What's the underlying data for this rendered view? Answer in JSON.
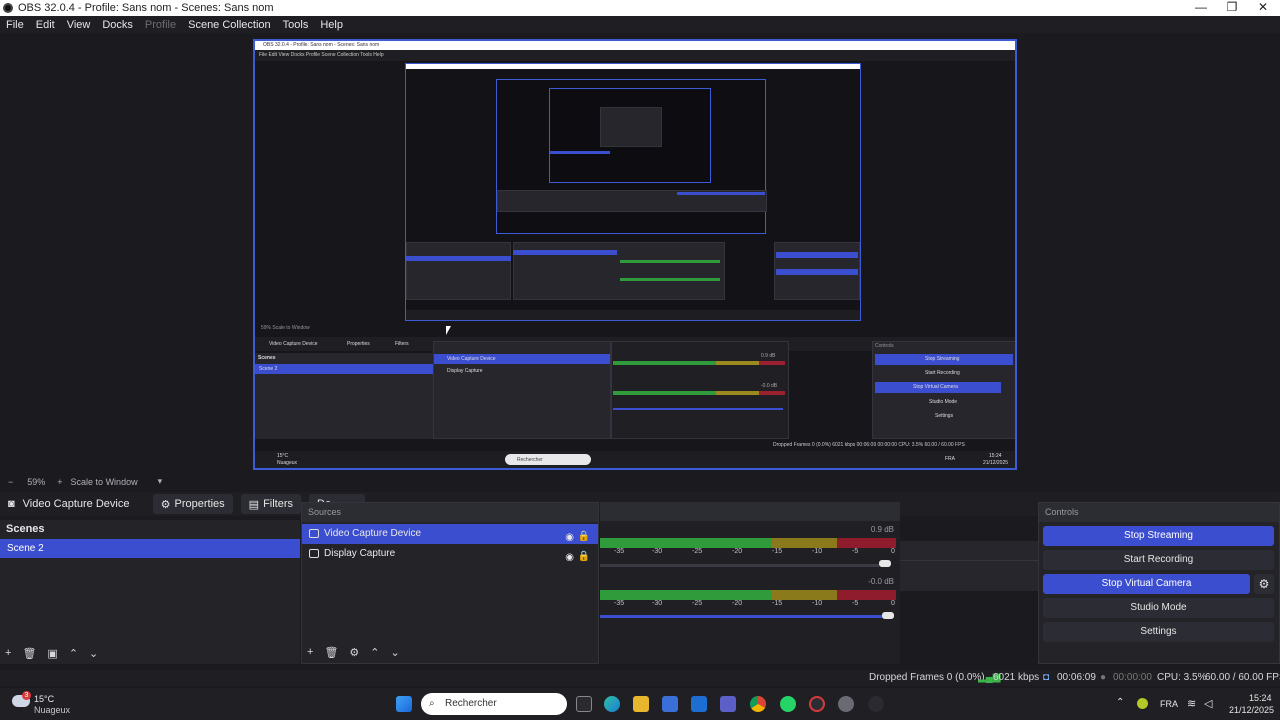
{
  "window": {
    "title": "OBS 32.0.4 - Profile: Sans nom - Scenes: Sans nom",
    "minimize": "—",
    "maximize": "❐",
    "close": "✕"
  },
  "menu": {
    "items": [
      "File",
      "Edit",
      "View",
      "Docks",
      "Profile",
      "Scene Collection",
      "Tools",
      "Help"
    ],
    "disabled": [
      "Profile"
    ]
  },
  "preview_nested": {
    "title": "OBS 32.0.4 - Profile: Sans nom - Scenes: Sans nom",
    "menu": "File  Edit  View  Docks  Profile  Scene Collection  Tools  Help",
    "zoom": "59%   Scale to Window",
    "context_source": "Video Capture Device",
    "context_props": "Properties",
    "context_filters": "Filters",
    "scenes_title": "Scenes",
    "scene": "Scene 2",
    "sources_title": "Sources",
    "src1": "Video Capture Device",
    "src2": "Display Capture",
    "controls_title": "Controls",
    "c1": "Stop Streaming",
    "c2": "Start Recording",
    "c3": "Stop Virtual Camera",
    "c4": "Studio Mode",
    "c5": "Settings",
    "status": "Dropped Frames 0 (0.0%)   6021 kbps   00:06:09   00:00:00   CPU: 3.5%   60.00 / 60.00 FPS",
    "weather": "15°C",
    "weather_desc": "Nuageux",
    "search": "Rechercher",
    "lang": "FRA",
    "time": "15:24",
    "date": "21/12/2025",
    "db1": "0.9 dB",
    "db2": "-0.0 dB"
  },
  "zoom": {
    "minus": "−",
    "level": "59%",
    "plus": "+",
    "mode": "Scale to Window"
  },
  "context": {
    "source_name": "Video Capture Device",
    "properties": "Properties",
    "filters": "Filters",
    "partial": "De"
  },
  "scenes": {
    "title": "Scenes",
    "items": [
      "Scene 2"
    ]
  },
  "sources": {
    "title": "Sources",
    "items": [
      "Video Capture Device",
      "Display Capture"
    ]
  },
  "mixer": {
    "track1_db": "0.9 dB",
    "track2_db": "-0.0 dB",
    "scale": [
      "-45",
      "-40",
      "-35",
      "-30",
      "-25",
      "-20",
      "-15",
      "-10",
      "-5",
      "0"
    ],
    "track1_volume": 0.95,
    "track2_volume": 1.0
  },
  "controls": {
    "title": "Controls",
    "stop_streaming": "Stop Streaming",
    "start_recording": "Start Recording",
    "stop_virtual_camera": "Stop Virtual Camera",
    "studio_mode": "Studio Mode",
    "settings": "Settings"
  },
  "status": {
    "dropped": "Dropped Frames 0 (0.0%)",
    "bitrate": "6021 kbps",
    "stream_time": "00:06:09",
    "rec_time": "00:00:00",
    "cpu": "CPU: 3.5%",
    "fps": "60.00 / 60.00 FPS"
  },
  "taskbar": {
    "temperature": "15°C",
    "weather": "Nuageux",
    "badge": "3",
    "search_placeholder": "Rechercher",
    "language": "FRA",
    "time": "15:24",
    "date": "21/12/2025"
  },
  "colors": {
    "accent": "#3c4ed0",
    "meter_green": "#2f9b3a",
    "meter_yellow": "#9a8a20",
    "meter_red": "#9b2030"
  }
}
